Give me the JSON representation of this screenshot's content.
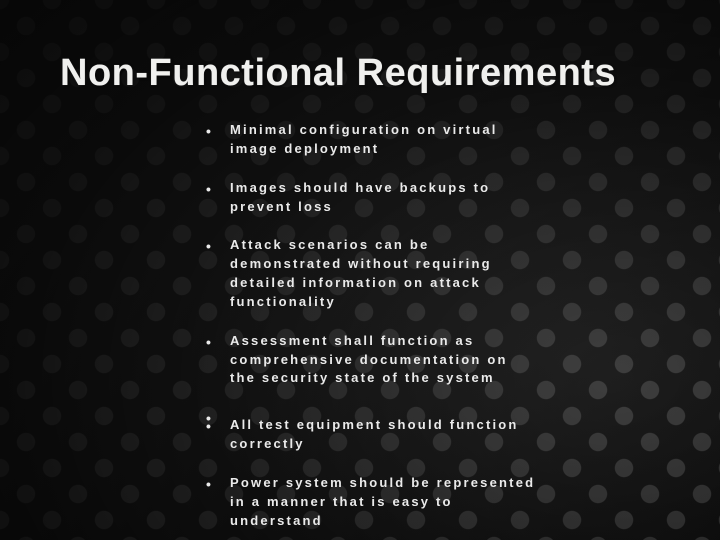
{
  "title": "Non-Functional Requirements",
  "bullets": [
    "Minimal configuration on virtual image deployment",
    "Images should have backups to prevent loss",
    "Attack scenarios can be demonstrated without requiring detailed information on attack functionality",
    "Assessment shall function as comprehensive documentation on the security state of the system",
    "",
    "All test equipment should function correctly",
    "Power system should be represented in a manner that is easy to understand"
  ]
}
